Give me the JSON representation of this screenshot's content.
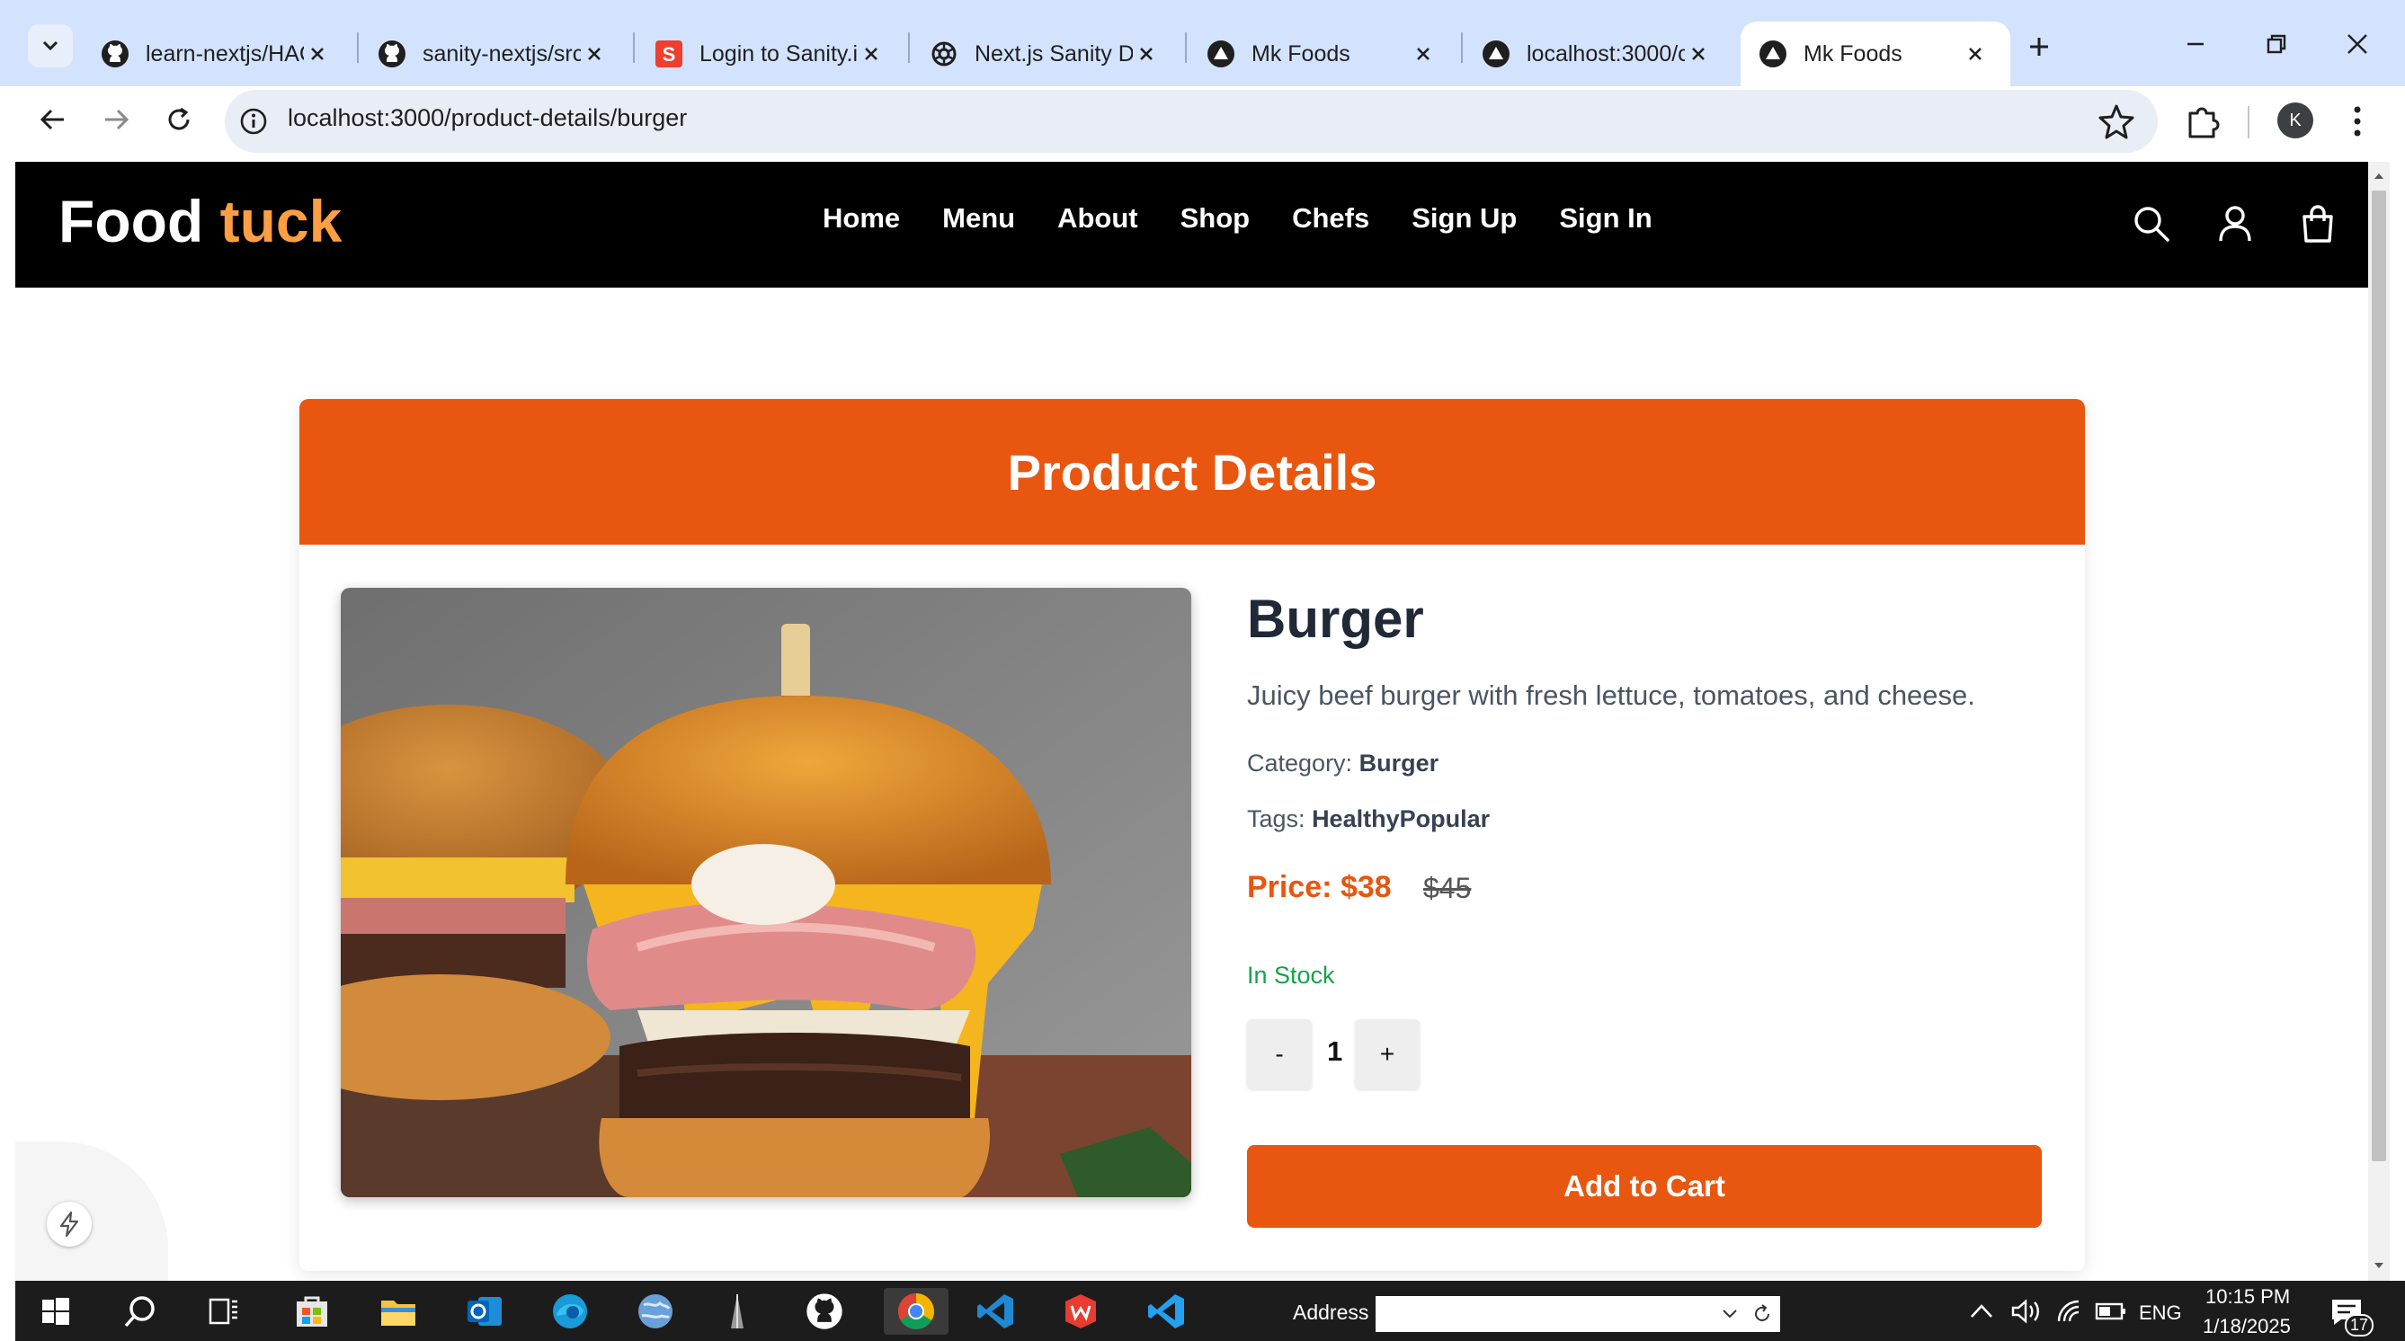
{
  "browser": {
    "tabs": [
      {
        "title": "learn-nextjs/HAC",
        "favicon": "github-icon"
      },
      {
        "title": "sanity-nextjs/src",
        "favicon": "github-icon"
      },
      {
        "title": "Login to Sanity.i",
        "favicon": "sanity-icon"
      },
      {
        "title": "Next.js Sanity Da",
        "favicon": "openai-icon"
      },
      {
        "title": "Mk Foods",
        "favicon": "nextjs-icon"
      },
      {
        "title": "localhost:3000/c",
        "favicon": "nextjs-icon"
      },
      {
        "title": "Mk Foods",
        "favicon": "nextjs-icon",
        "active": true
      }
    ],
    "url": "localhost:3000/product-details/burger",
    "profile_initial": "K"
  },
  "site": {
    "logo_main": "Food",
    "logo_accent": "tuck",
    "nav": [
      "Home",
      "Menu",
      "About",
      "Shop",
      "Chefs",
      "Sign Up",
      "Sign In"
    ]
  },
  "product": {
    "section_title": "Product Details",
    "name": "Burger",
    "description": "Juicy beef burger with fresh lettuce, tomatoes, and cheese.",
    "category_label": "Category:",
    "category": "Burger",
    "tags_label": "Tags:",
    "tags": "HealthyPopular",
    "price": "Price: $38",
    "original_price": "$45",
    "stock": "In Stock",
    "quantity": "1",
    "decrement_label": "-",
    "increment_label": "+",
    "add_to_cart": "Add to Cart"
  },
  "taskbar": {
    "address_label": "Address",
    "language": "ENG",
    "time": "10:15 PM",
    "date": "1/18/2025",
    "notifications": "17"
  },
  "colors": {
    "accent": "#e8560f",
    "logo_accent": "#ff9f43",
    "in_stock": "#16a34a",
    "tab_strip": "#d3e3fd"
  }
}
